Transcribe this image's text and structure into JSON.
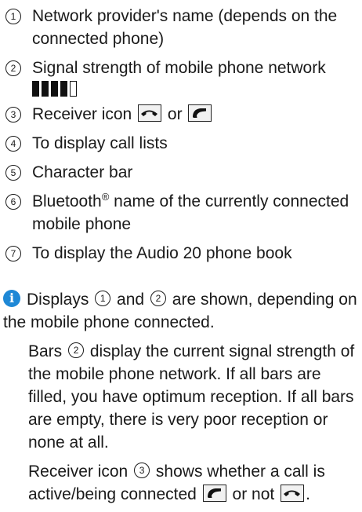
{
  "legend": [
    {
      "num": "1",
      "text": "Network provider's name (depends on the connected phone)"
    },
    {
      "num": "2",
      "text": "Signal strength of mobile phone network"
    },
    {
      "num": "3",
      "text_before": "Receiver icon",
      "text_mid": "or"
    },
    {
      "num": "4",
      "text": "To display call lists"
    },
    {
      "num": "5",
      "text": "Character bar"
    },
    {
      "num": "6",
      "text_before": "Bluetooth",
      "sup": "®",
      "text_after": " name of the currently connected mobile phone"
    },
    {
      "num": "7",
      "text": "To display the Audio 20 phone book"
    }
  ],
  "signal": {
    "filled_bars": 4,
    "total_bars": 5
  },
  "icons": {
    "info": "info-icon",
    "receiver_inactive": "receiver-down-icon",
    "receiver_active": "receiver-up-icon",
    "info_color": "#1e88d6"
  },
  "note": {
    "p1_a": "Displays",
    "p1_ref1": "1",
    "p1_b": "and",
    "p1_ref2": "2",
    "p1_c": "are shown, depending on the mobile phone connected.",
    "p2_a": "Bars",
    "p2_ref": "2",
    "p2_b": "display the current signal strength of the mobile phone network. If all bars are filled, you have optimum reception. If all bars are empty, there is very poor reception or none at all.",
    "p3_a": "Receiver icon",
    "p3_ref": "3",
    "p3_b": "shows whether a call is active/being connected",
    "p3_c": "or not",
    "p3_end": "."
  }
}
